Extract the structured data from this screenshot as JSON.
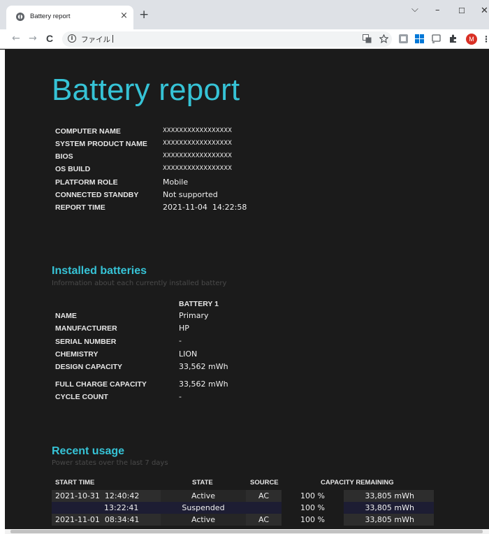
{
  "browser": {
    "tab_title": "Battery report",
    "new_tab": "+",
    "tab_close": "×",
    "address": "ファイル",
    "info_icon_glyph": "i",
    "avatar_letter": "M",
    "window_controls": {
      "minimize": "–",
      "maximize": "☐",
      "close": "✕",
      "tab_search": "⌵"
    },
    "nav": {
      "back": "←",
      "forward": "→",
      "reload": "C"
    },
    "profile_color": "#d93025"
  },
  "report": {
    "title": "Battery report",
    "system_info": [
      {
        "label": "COMPUTER NAME",
        "value": "XXXXXXXXXXXXXXXXX"
      },
      {
        "label": "SYSTEM PRODUCT NAME",
        "value": "XXXXXXXXXXXXXXXXX"
      },
      {
        "label": "BIOS",
        "value": "XXXXXXXXXXXXXXXXX"
      },
      {
        "label": "OS BUILD",
        "value": "XXXXXXXXXXXXXXXXX"
      },
      {
        "label": "PLATFORM ROLE",
        "value": "Mobile"
      },
      {
        "label": "CONNECTED STANDBY",
        "value": "Not supported"
      },
      {
        "label": "REPORT TIME",
        "value": "2021-11-04  14:22:58"
      }
    ],
    "installed_batteries": {
      "heading": "Installed batteries",
      "subheading": "Information about each currently installed battery",
      "column": "BATTERY 1",
      "rows": [
        {
          "label": "NAME",
          "value": "Primary"
        },
        {
          "label": "MANUFACTURER",
          "value": "HP"
        },
        {
          "label": "SERIAL NUMBER",
          "value": "-"
        },
        {
          "label": "CHEMISTRY",
          "value": "LION"
        },
        {
          "label": "DESIGN CAPACITY",
          "value": "33,562 mWh"
        },
        {
          "label": "FULL CHARGE CAPACITY",
          "value": "33,562 mWh"
        },
        {
          "label": "CYCLE COUNT",
          "value": "-"
        }
      ]
    },
    "recent_usage": {
      "heading": "Recent usage",
      "subheading": "Power states over the last 7 days",
      "columns": {
        "start_time": "START TIME",
        "state": "STATE",
        "source": "SOURCE",
        "capacity": "CAPACITY REMAINING"
      },
      "rows": [
        {
          "start_time": "2021-10-31  12:40:42",
          "state": "Active",
          "source": "AC",
          "percent": "100 %",
          "energy": "33,805 mWh"
        },
        {
          "start_time": "13:22:41",
          "state": "Suspended",
          "source": "",
          "percent": "100 %",
          "energy": "33,805 mWh"
        },
        {
          "start_time": "2021-11-01  08:34:41",
          "state": "Active",
          "source": "AC",
          "percent": "100 %",
          "energy": "33,805 mWh"
        }
      ]
    },
    "colors": {
      "accent": "#36c3d6",
      "background": "#1b1b1b",
      "row_dark": "#262626",
      "row_navy": "#1d1d33",
      "subtle_text": "#4a4a4a"
    }
  }
}
